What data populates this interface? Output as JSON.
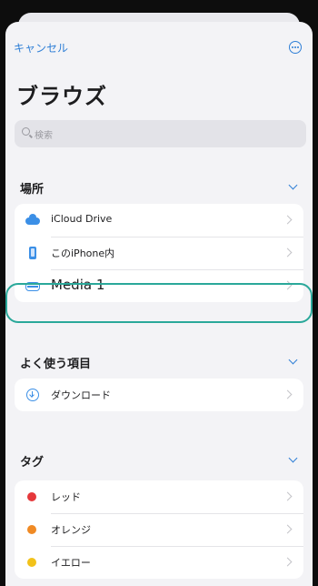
{
  "nav": {
    "cancel_label": "キャンセル",
    "more_icon": "ellipsis-circle-icon"
  },
  "title": "ブラウズ",
  "search": {
    "placeholder": "検索"
  },
  "sections": {
    "locations": {
      "header": "場所",
      "items": [
        {
          "label": "iCloud Drive",
          "icon": "icloud-icon"
        },
        {
          "label": "このiPhone内",
          "icon": "iphone-icon"
        },
        {
          "label": "Media 1",
          "icon": "external-drive-icon",
          "highlighted": true
        }
      ]
    },
    "favorites": {
      "header": "よく使う項目",
      "items": [
        {
          "label": "ダウンロード",
          "icon": "download-icon"
        }
      ]
    },
    "tags": {
      "header": "タグ",
      "items": [
        {
          "label": "レッド",
          "color": "#e5383b"
        },
        {
          "label": "オレンジ",
          "color": "#f08a24"
        },
        {
          "label": "イエロー",
          "color": "#f2c21a"
        }
      ]
    }
  },
  "colors": {
    "accent": "#2f7fd6",
    "highlight_ring": "#2aa89a"
  }
}
